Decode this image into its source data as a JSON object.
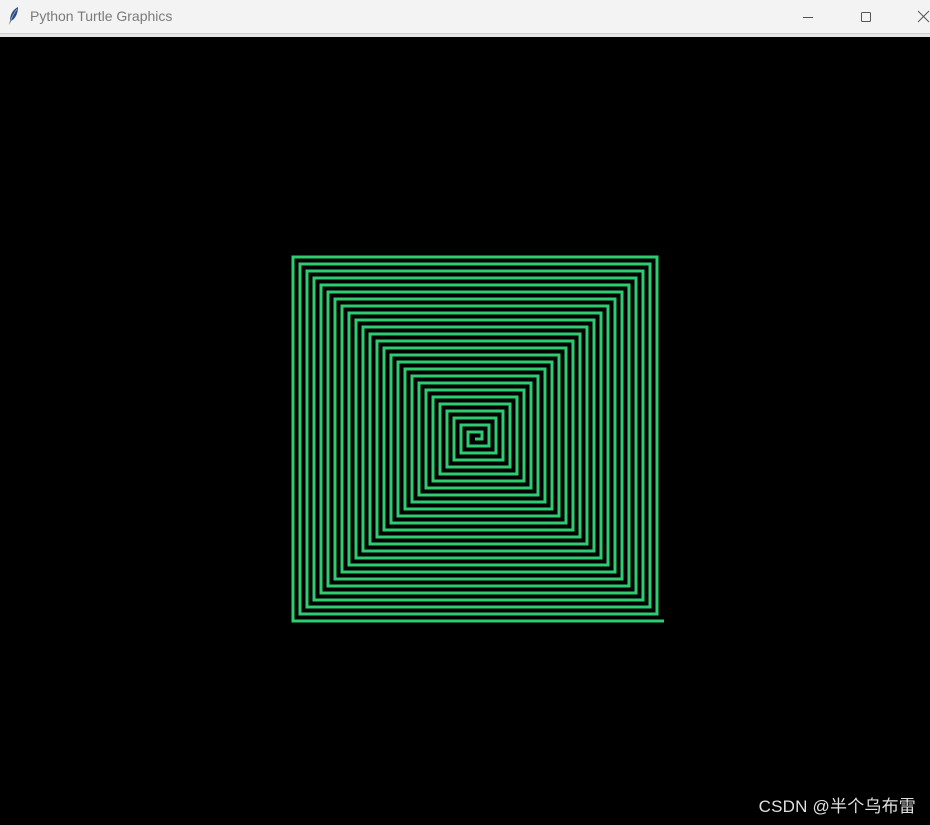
{
  "window": {
    "title": "Python Turtle Graphics",
    "icons": {
      "app": "feather-icon",
      "minimize": "minimize-icon",
      "maximize": "maximize-icon",
      "close": "close-icon"
    }
  },
  "canvas": {
    "background": "#000000",
    "pen_color": "#2ecc71"
  },
  "watermark": {
    "text": "CSDN @半个乌布雷"
  }
}
